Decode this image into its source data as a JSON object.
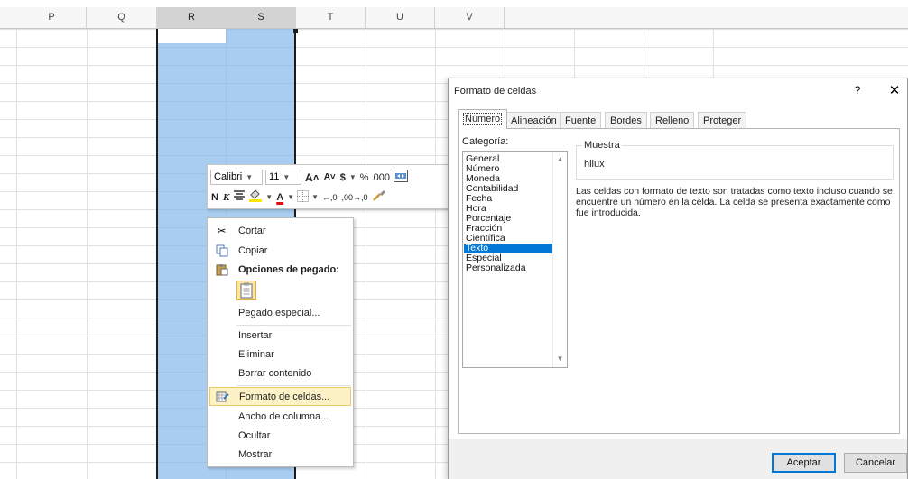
{
  "sheet": {
    "columns": [
      "P",
      "Q",
      "R",
      "S",
      "T",
      "U",
      "V"
    ],
    "selected_columns": [
      "R",
      "S"
    ]
  },
  "mini_toolbar": {
    "font_name": "Calibri",
    "font_size": "11",
    "grow_font": "A˄",
    "shrink_font": "A˅",
    "currency": "$",
    "percent": "%",
    "thousands": "000",
    "bold": "N",
    "italic": "K",
    "font_color": "A",
    "increase_decimal": "←,0",
    "decrease_decimal": ",00→,0"
  },
  "context_menu": {
    "cut": "Cortar",
    "copy": "Copiar",
    "paste_options": "Opciones de pegado:",
    "paste_special": "Pegado especial...",
    "insert": "Insertar",
    "delete": "Eliminar",
    "clear_contents": "Borrar contenido",
    "format_cells": "Formato de celdas...",
    "column_width": "Ancho de columna...",
    "hide": "Ocultar",
    "show": "Mostrar"
  },
  "dialog": {
    "title": "Formato de celdas",
    "help": "?",
    "close": "✕",
    "tabs": [
      "Número",
      "Alineación",
      "Fuente",
      "Bordes",
      "Relleno",
      "Proteger"
    ],
    "category_label": "Categoría:",
    "categories": [
      "General",
      "Número",
      "Moneda",
      "Contabilidad",
      "Fecha",
      "Hora",
      "Porcentaje",
      "Fracción",
      "Científica",
      "Texto",
      "Especial",
      "Personalizada"
    ],
    "selected_category": "Texto",
    "sample_label": "Muestra",
    "sample_value": "hilux",
    "description": "Las celdas con formato de texto son tratadas como texto incluso cuando se encuentre un número en la celda. La celda se presenta exactamente como fue introducida.",
    "ok": "Aceptar",
    "cancel": "Cancelar"
  },
  "colors": {
    "selection": "#a9cdf0",
    "list_selected": "#0078d7",
    "menu_highlight": "#fdf1c6"
  }
}
